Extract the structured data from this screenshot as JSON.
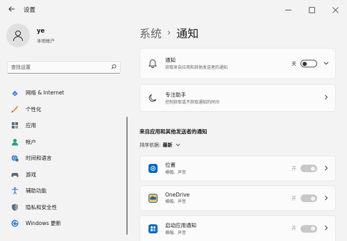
{
  "window": {
    "title": "设置"
  },
  "profile": {
    "name": "ye",
    "account_type": "本地帐户"
  },
  "search": {
    "placeholder": "查找设置"
  },
  "sidebar": {
    "items": [
      {
        "label": "网络 & Internet",
        "icon": "wifi-icon"
      },
      {
        "label": "个性化",
        "icon": "brush-icon"
      },
      {
        "label": "应用",
        "icon": "apps-icon"
      },
      {
        "label": "帐户",
        "icon": "person-icon"
      },
      {
        "label": "时间和语言",
        "icon": "globe-clock-icon"
      },
      {
        "label": "游戏",
        "icon": "gamepad-icon"
      },
      {
        "label": "辅助功能",
        "icon": "accessibility-icon"
      },
      {
        "label": "隐私和安全性",
        "icon": "shield-icon"
      },
      {
        "label": "Windows 更新",
        "icon": "update-icon"
      }
    ]
  },
  "breadcrumb": {
    "parent": "系统",
    "separator": "›",
    "current": "通知"
  },
  "notifications": {
    "title": "通知",
    "subtitle": "获取来自应用和其他发送者的通知",
    "toggle_label": "关"
  },
  "focus_assist": {
    "title": "专注助手",
    "subtitle": "控制获取或不获取通知的时间"
  },
  "apps_section": {
    "title": "来自应用和其他发送者的通知",
    "sort_label": "排序依据:",
    "sort_value": "最新",
    "apps": [
      {
        "name": "位置",
        "subtitle": "横幅、声音",
        "toggle_label": "开",
        "icon": "location-icon",
        "color": "#0067c0"
      },
      {
        "name": "OneDrive",
        "subtitle": "横幅、声音",
        "toggle_label": "开",
        "icon": "onedrive-icon",
        "color": "#f2c94c"
      },
      {
        "name": "启动应用通知",
        "subtitle": "横幅、声音",
        "toggle_label": "开",
        "icon": "startup-apps-icon",
        "color": "#0067c0"
      }
    ]
  },
  "colors": {
    "accent": "#0067c0",
    "background": "#f3f3f3",
    "card": "#fbfbfb"
  }
}
